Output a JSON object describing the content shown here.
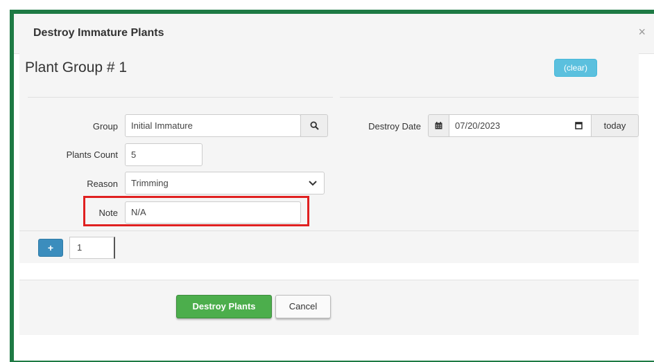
{
  "dialog": {
    "title": "Destroy Immature Plants",
    "close_glyph": "×"
  },
  "plant_group": {
    "title": "Plant Group # 1",
    "clear_label": "(clear)"
  },
  "form": {
    "group": {
      "label": "Group",
      "value": "Initial Immature",
      "icon": "search-icon"
    },
    "plants_count": {
      "label": "Plants Count",
      "value": "5"
    },
    "reason": {
      "label": "Reason",
      "value": "Trimming",
      "icon": "chevron-down-icon"
    },
    "note": {
      "label": "Note",
      "value": "N/A"
    },
    "destroy_date": {
      "label": "Destroy Date",
      "value": "07/20/2023",
      "calendar_icon": "calendar-icon",
      "today_label": "today"
    }
  },
  "add_row": {
    "plus_glyph": "+",
    "count_value": "1"
  },
  "footer": {
    "destroy_label": "Destroy Plants",
    "cancel_label": "Cancel"
  },
  "colors": {
    "frame": "#1e7a44",
    "primary_green": "#4cae4c",
    "info_blue": "#5bc0de",
    "add_blue": "#3b8dbd",
    "highlight_red": "#e02020"
  }
}
